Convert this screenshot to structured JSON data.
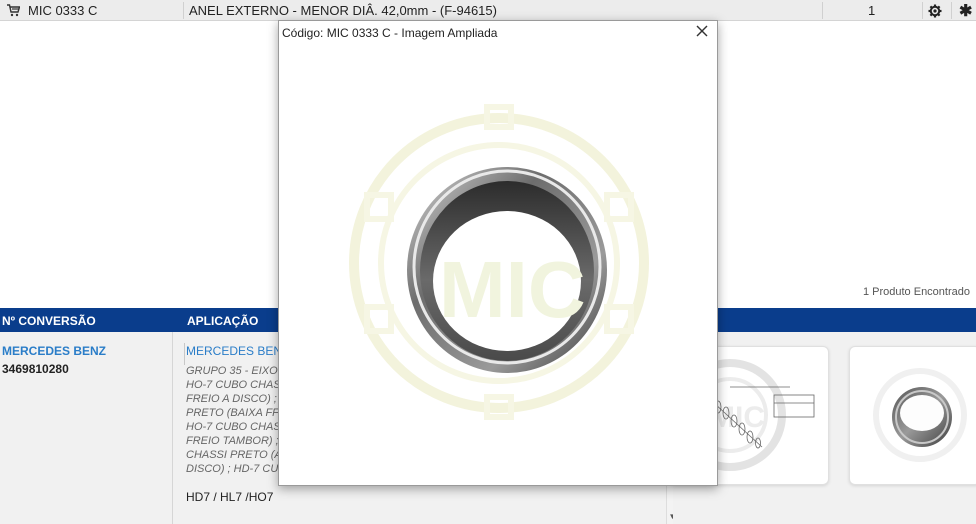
{
  "product_row": {
    "code": "MIC 0333 C",
    "description": "ANEL EXTERNO - MENOR DIÂ. 42,0mm - (F-94615)",
    "quantity": "1"
  },
  "results": {
    "count_text": "1 Produto Encontrado"
  },
  "table_header": {
    "conversion": "Nº CONVERSÃO",
    "application": "APLICAÇÃO"
  },
  "conversion": {
    "manufacturer": "MERCEDES BENZ",
    "reference": "3469810280"
  },
  "application": {
    "manufacturer": "MERCEDES BEN",
    "lines": [
      "GRUPO 35 - EIXO",
      "HO-7 CUBO CHAS",
      "FREIO A DISCO) ;",
      "PRETO (BAIXA FF",
      "HO-7 CUBO CHAS",
      "FREIO TAMBOR) ;",
      "CHASSI PRETO (A",
      "DISCO) ; HD-7 CU"
    ],
    "models": "HD7 / HL7 /HO7"
  },
  "modal": {
    "title": "Código: MIC 0333 C - Imagem Ampliada",
    "watermark": "MIC"
  },
  "colors": {
    "header_bar": "#0a3d8c",
    "link_blue": "#2a7dc8",
    "row_bg": "#ececec"
  },
  "icons": {
    "cart": "cart-icon",
    "gear": "gear-icon",
    "star": "asterisk-icon",
    "close": "close-icon"
  }
}
